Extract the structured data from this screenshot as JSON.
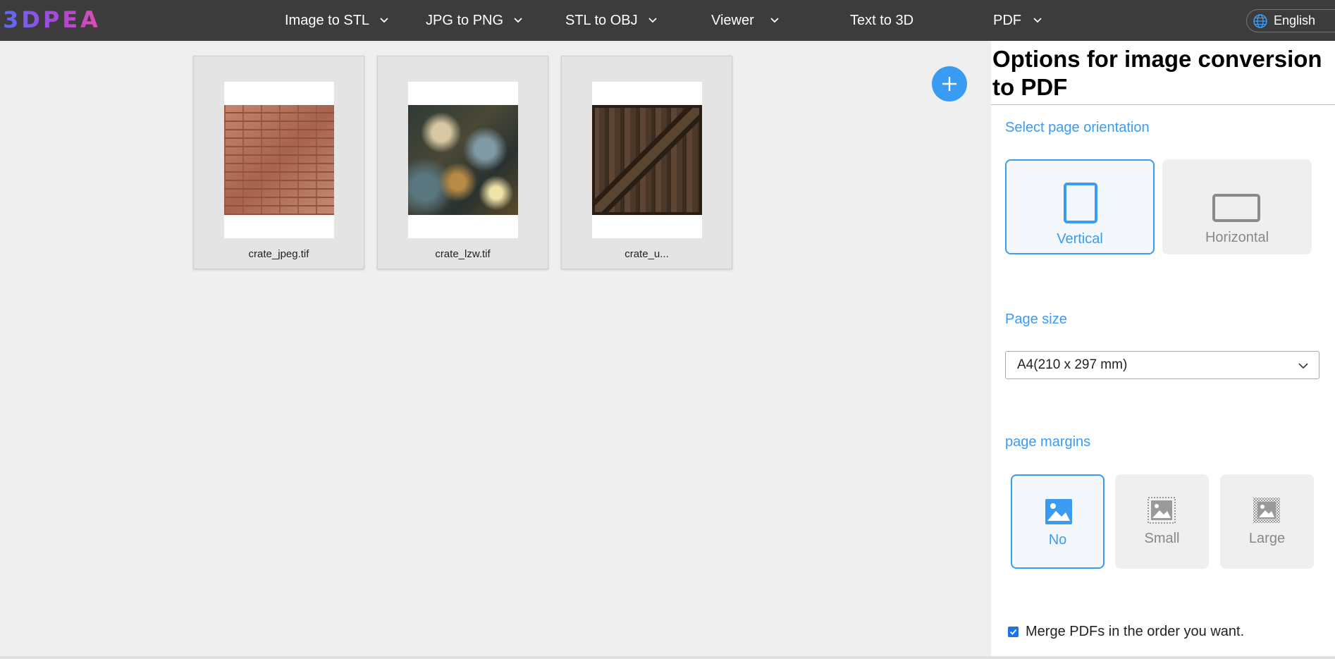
{
  "header": {
    "logo_text": "3DPEA",
    "nav": [
      {
        "label": "Image to STL",
        "has_dropdown": true
      },
      {
        "label": "JPG to PNG",
        "has_dropdown": true
      },
      {
        "label": "STL to OBJ",
        "has_dropdown": true
      },
      {
        "label": "Viewer",
        "has_dropdown": true
      },
      {
        "label": "Text to 3D",
        "has_dropdown": false
      },
      {
        "label": "PDF",
        "has_dropdown": true
      }
    ],
    "language": {
      "label": "English",
      "icon": "globe-icon"
    }
  },
  "files": [
    {
      "name": "crate_jpeg.tif",
      "thumbnail": "brick"
    },
    {
      "name": "crate_lzw.tif",
      "thumbnail": "marble"
    },
    {
      "name": "crate_u...",
      "thumbnail": "wood-crate"
    }
  ],
  "add_button": {
    "icon": "plus-icon"
  },
  "options": {
    "title": "Options for image conversion to PDF",
    "orientation": {
      "label": "Select page orientation",
      "options": [
        {
          "label": "Vertical",
          "selected": true
        },
        {
          "label": "Horizontal",
          "selected": false
        }
      ]
    },
    "page_size": {
      "label": "Page size",
      "value": "A4(210 x 297 mm)"
    },
    "margins": {
      "label": "page margins",
      "options": [
        {
          "label": "No",
          "selected": true
        },
        {
          "label": "Small",
          "selected": false
        },
        {
          "label": "Large",
          "selected": false
        }
      ]
    },
    "merge": {
      "label": "Merge PDFs in the order you want.",
      "checked": true
    }
  },
  "colors": {
    "accent": "#3a9bf2",
    "topbar": "#3c3c3c",
    "logo_gradient": [
      "#5b6cf5",
      "#b044d8",
      "#e04fb0"
    ]
  }
}
